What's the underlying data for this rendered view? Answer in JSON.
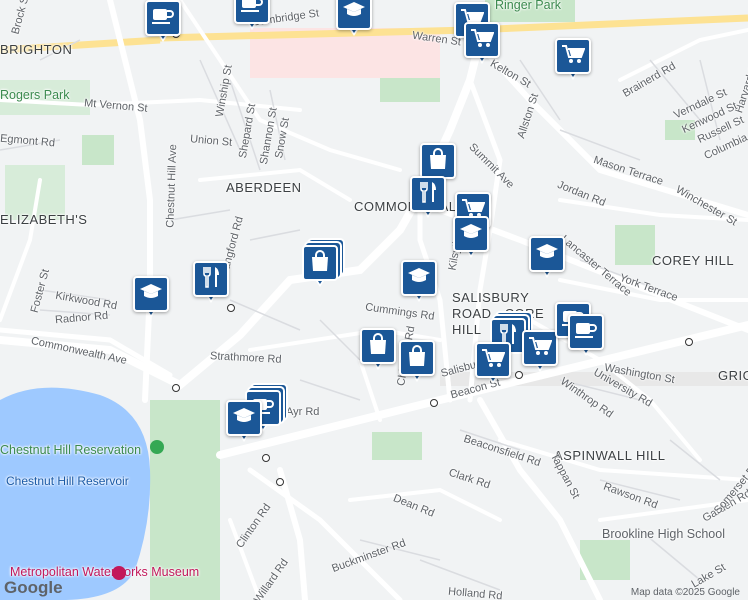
{
  "map": {
    "neighborhoods": [
      "BRIGHTON",
      "ABERDEEN",
      "COMMONWEALTH",
      "COREY HILL",
      "SALISBURY ROAD - CORE HILL",
      "ASPINWALL HILL",
      "GRIGGS PARK",
      "ELIZABETH'S"
    ],
    "streets": [
      "Cambridge St",
      "Warren St",
      "Kelton St",
      "Allston St",
      "Summit Ave",
      "Brainerd Rd",
      "Harvard Ave",
      "Verndale St",
      "Kenwood St",
      "Russell St",
      "Columbia St",
      "Winchester St",
      "Mason Terrace",
      "Jordan Rd",
      "Lancaster Terrace",
      "York Terrace",
      "Washington St",
      "University Rd",
      "Winthrop Rd",
      "Tappan St",
      "Beacon St",
      "Beaconsfield Rd",
      "Clark Rd",
      "Dean Rd",
      "Clinton Rd",
      "Rawson Rd",
      "Garden Rd",
      "Somerset Rd",
      "Buckminster Rd",
      "Chestnut Hill Ave",
      "Commonwealth Ave",
      "Strathmore Rd",
      "Cummings Rd",
      "Mt Vernon St",
      "Union St",
      "Shepard St",
      "Winship St",
      "Shannon St",
      "Snow St",
      "Kirkwood Rd",
      "Radnor Rd",
      "Foster St",
      "Langford Rd",
      "Lake St",
      "Willard Rd",
      "Holland Rd",
      "Brock St",
      "Egmont Rd",
      "Chiswick Rd",
      "Kilsyth Rd",
      "Ayr Rd",
      "Salisbury Rd"
    ],
    "parks": [
      "Rogers Park",
      "Ringer Park",
      "Chestnut Hill Reservation"
    ],
    "water": [
      "Chestnut Hill Reservoir"
    ],
    "pois": [
      "Brookline High School",
      "Metropolitan Waterworks Museum"
    ],
    "attribution": "Map data ©2025 Google",
    "logo": "Google"
  },
  "markers": [
    {
      "id": "m1",
      "type": "cafe-icon"
    },
    {
      "id": "m2",
      "type": "cafe-icon"
    },
    {
      "id": "m3",
      "type": "school-icon"
    },
    {
      "id": "m4",
      "type": "grocery-icon"
    },
    {
      "id": "m5",
      "type": "grocery-icon"
    },
    {
      "id": "m6",
      "type": "grocery-icon"
    },
    {
      "id": "m7",
      "type": "shopping-icon"
    },
    {
      "id": "m8",
      "type": "restaurant-icon"
    },
    {
      "id": "m9",
      "type": "grocery-icon"
    },
    {
      "id": "m10",
      "type": "school-icon"
    },
    {
      "id": "m11",
      "type": "school-icon"
    },
    {
      "id": "m12",
      "type": "shopping-icon"
    },
    {
      "id": "m13",
      "type": "restaurant-icon"
    },
    {
      "id": "m14",
      "type": "school-icon"
    },
    {
      "id": "m15",
      "type": "school-icon"
    },
    {
      "id": "m16",
      "type": "shopping-icon"
    },
    {
      "id": "m17",
      "type": "shopping-icon"
    },
    {
      "id": "m18",
      "type": "restaurant-icon"
    },
    {
      "id": "m19",
      "type": "grocery-icon"
    },
    {
      "id": "m20",
      "type": "grocery-icon"
    },
    {
      "id": "m21",
      "type": "cafe-icon"
    },
    {
      "id": "m22",
      "type": "cafe-icon"
    },
    {
      "id": "m23",
      "type": "cafe-icon"
    },
    {
      "id": "m24",
      "type": "school-icon"
    }
  ]
}
